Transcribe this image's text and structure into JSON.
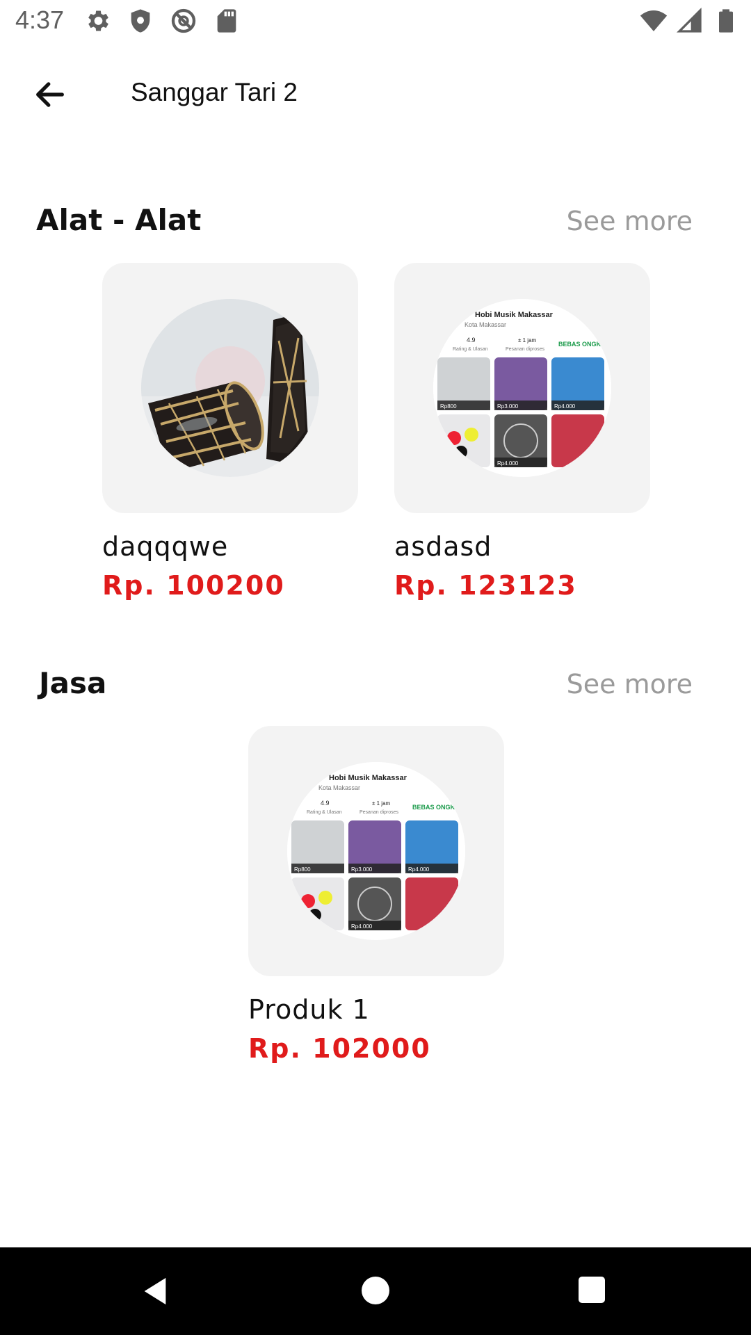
{
  "status_bar": {
    "time": "4:37"
  },
  "app_bar": {
    "title": "Sanggar Tari 2"
  },
  "sections": [
    {
      "title": "Alat - Alat",
      "see_more": "See more",
      "items": [
        {
          "name": "daqqqwe",
          "price": "Rp. 100200"
        },
        {
          "name": "asdasd",
          "price": "Rp. 123123"
        }
      ]
    },
    {
      "title": "Jasa",
      "see_more": "See more",
      "items": [
        {
          "name": "Produk 1",
          "price": "Rp. 102000"
        }
      ]
    }
  ],
  "shop_image": {
    "shop_name": "Hobi Musik Makassar",
    "city": "Kota Makassar",
    "rating": "4.9",
    "rating_label": "Rating & Ulasan",
    "process_time": "± 1 jam",
    "process_label": "Pesanan diproses",
    "badge": "BEBAS ONGKIR",
    "prices": [
      "Rp800",
      "Rp3.000",
      "Rp4.000",
      "Rp4.000"
    ]
  },
  "colors": {
    "price": "#e01b1b",
    "see_more": "#9a9a9a",
    "card_bg": "#f3f3f3"
  }
}
